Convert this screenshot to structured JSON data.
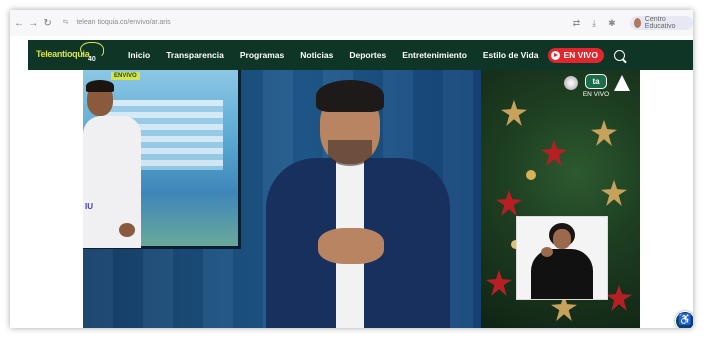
{
  "browser": {
    "url": "telean tioquia.co/envivo/ar.aris",
    "back_icon": "arrow-left-icon",
    "forward_icon": "arrow-right-icon",
    "reload_icon": "reload-icon",
    "profile_label": "Centro Educativo"
  },
  "site": {
    "logo_text": "Teleantioquia",
    "logo_year": "40",
    "menu": [
      "Inicio",
      "Transparencia",
      "Programas",
      "Noticias",
      "Deportes",
      "Entretenimiento",
      "Estilo de Vida"
    ],
    "live_label": "EN VIVO",
    "colors": {
      "nav_bg": "#0f3526",
      "live_red": "#e3262b",
      "logo_green": "#d8e34a"
    }
  },
  "video": {
    "channel_badge": "ta",
    "channel_live_label": "EN VIVO",
    "screen_logo": "IU",
    "screen_banner": "ENVIVO"
  },
  "accessibility": {
    "icon": "accessibility-icon",
    "glyph": "♿"
  }
}
